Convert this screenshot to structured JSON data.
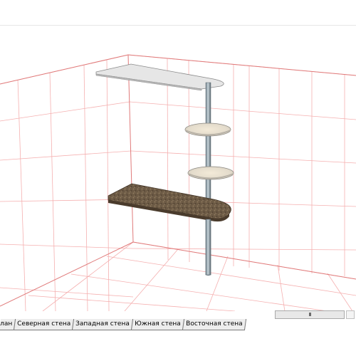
{
  "view_tabs": [
    {
      "label": "лан"
    },
    {
      "label": "Северная стена"
    },
    {
      "label": "Западная стена"
    },
    {
      "label": "Южная стена"
    },
    {
      "label": "Восточная стена"
    }
  ],
  "scrollbar": {
    "thumb_grip": "III"
  },
  "colors": {
    "grid": "#f3a6a6",
    "grid_strong": "#e07070",
    "glass": "#e4e4e4",
    "pole": "#8a9aa3",
    "worktop": "#6a5844"
  },
  "icons": {
    "scroll_thumb": "scroll-thumb-grip-icon"
  }
}
